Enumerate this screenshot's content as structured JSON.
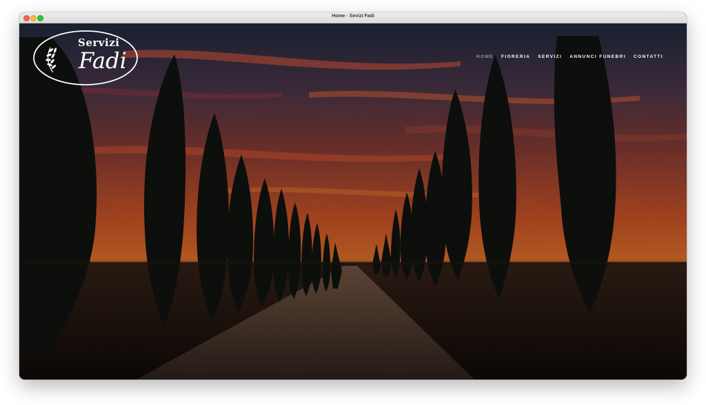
{
  "window": {
    "title": "Home - Sevizi Fadi"
  },
  "logo": {
    "line1": "Servizi",
    "line2": "Fadi"
  },
  "nav": {
    "items": [
      {
        "label": "HOME",
        "active": true
      },
      {
        "label": "FIORERIA",
        "active": false
      },
      {
        "label": "SERVIZI",
        "active": false
      },
      {
        "label": "ANNUNCI FUNEBRI",
        "active": false
      },
      {
        "label": "CONTATTI",
        "active": false
      }
    ]
  },
  "hero": {
    "description": ""
  },
  "colors": {
    "nav_active": "#9b9b9b",
    "nav_text": "#ffffff",
    "sky_top": "#1c2435",
    "sky_glow": "#c2542a"
  }
}
